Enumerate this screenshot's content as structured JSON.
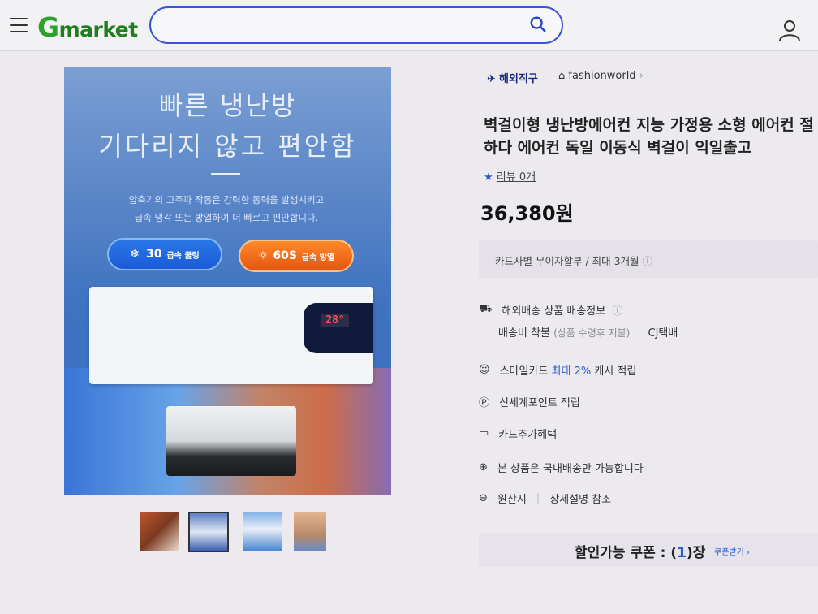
{
  "header": {
    "logo_g": "G",
    "logo_rest": "market",
    "search_placeholder": ""
  },
  "hero": {
    "line1": "빠른 냉난방",
    "line2": "기다리지 않고 편안함",
    "desc1": "압축기의 고주파 작동은 강력한 동력을 발생시키고",
    "desc2": "급속 냉각 또는 방열하여 더 빠르고 편안합니다.",
    "cool_value": "30",
    "cool_label": "급속 쿨링",
    "heat_value": "60S",
    "heat_label": "급속 방열",
    "display_temp": "28°"
  },
  "thumbnails": [
    "thumb-1",
    "thumb-2",
    "thumb-3",
    "thumb-4"
  ],
  "product": {
    "tag_overseas": "해외직구",
    "shop_name": "fashionworld",
    "title_line1": "벽걸이형 냉난방에어컨 지능 가정용 소형 에어컨 절",
    "title_line2": "하다 에어컨 독일 이동식 벽걸이 익일출고",
    "review": "리뷰 0개",
    "price": "36,380원",
    "card_info": "카드사별 무이자할부 / 최대 3개월",
    "shipping_title": "해외배송 상품 배송정보",
    "shipping_fee": "배송비 착불",
    "shipping_fee_note": "(상품 수령후 지불)",
    "courier": "CJ택배",
    "smile_card_prefix": "스마일카드",
    "smile_card_highlight": "최대 2%",
    "smile_card_suffix": "캐시 적립",
    "shinsegae": "신세계포인트 적립",
    "card_benefit": "카드추가혜택",
    "domestic": "본 상품은 국내배송만 가능합니다",
    "origin_label": "원산지",
    "origin_value": "상세설명 참조",
    "coupon_text_prefix": "할인가능 쿠폰 : (",
    "coupon_count": "1",
    "coupon_text_suffix": ")장",
    "coupon_link": "쿠폰받기 ›"
  },
  "colors": {
    "brand_green": "#2ea12b",
    "search_border": "#3a55d6",
    "link_blue": "#2b5ad4"
  }
}
